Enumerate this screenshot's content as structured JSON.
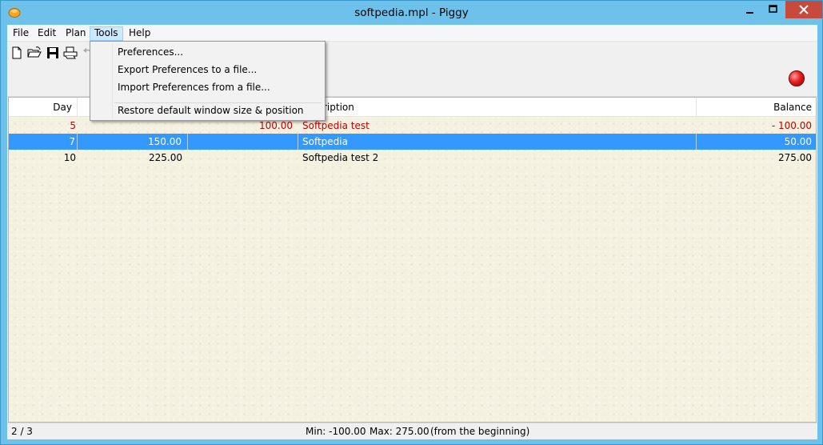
{
  "window": {
    "title": "softpedia.mpl - Piggy",
    "controls": {
      "minimize": "–",
      "maximize": "□",
      "close": "✕"
    }
  },
  "menubar": {
    "items": [
      "File",
      "Edit",
      "Plan",
      "Tools",
      "Help"
    ],
    "active": "Tools"
  },
  "tools_menu": {
    "items": [
      "Preferences...",
      "Export Preferences to a file...",
      "Import Preferences from a file...",
      "Restore default window size & position"
    ]
  },
  "toolbar": {
    "buttons": [
      "new-document-icon",
      "open-folder-icon",
      "save-icon",
      "print-icon",
      "undo-icon"
    ]
  },
  "table": {
    "headers": {
      "day": "Day",
      "income": "",
      "expense": "",
      "description": "Description",
      "balance": "Balance"
    },
    "header_description_visible": "ription",
    "rows": [
      {
        "day": "5",
        "income": "",
        "expense": "100.00",
        "description": "Softpedia test",
        "balance": "- 100.00"
      },
      {
        "day": "7",
        "income": "150.00",
        "expense": "",
        "description": "Softpedia",
        "balance": "50.00"
      },
      {
        "day": "10",
        "income": "225.00",
        "expense": "",
        "description": "Softpedia test 2",
        "balance": "275.00"
      }
    ]
  },
  "statusbar": {
    "position": "2 / 3",
    "min": "Min: -100.00",
    "max": "Max: 275.00",
    "range": "(from the beginning)"
  },
  "colors": {
    "selection": "#3399ff",
    "negative": "#c00000",
    "record_button": "#e52020"
  }
}
